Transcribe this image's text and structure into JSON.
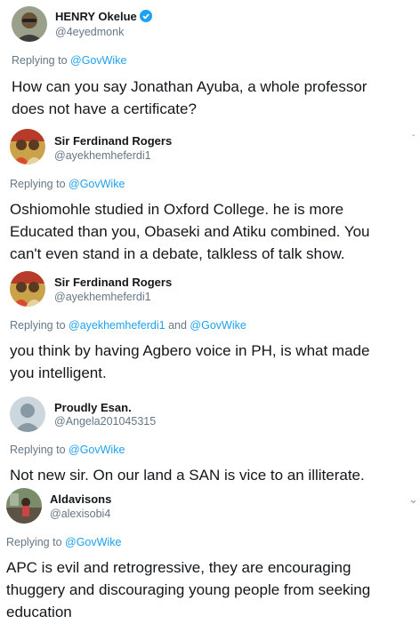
{
  "tweets": [
    {
      "name": "HENRY Okelue",
      "handle": "@4eyedmonk",
      "verified": true,
      "reply_prefix": "Replying to ",
      "reply_to": "@GovWike",
      "reply_to_2": "",
      "text_lines": [
        "How can you say Jonathan Ayuba, a whole professor",
        "does not have a certificate?"
      ]
    },
    {
      "name": "Sir Ferdinand Rogers",
      "handle": "@ayekhemheferdi1",
      "verified": false,
      "reply_prefix": "Replying to ",
      "reply_to": "@GovWike",
      "reply_to_2": "",
      "text_lines": [
        "Oshiomohle studied in Oxford College. he is more",
        "Educated than you, Obaseki and Atiku combined. You",
        "can't even stand in a debate, talkless of talk show."
      ]
    },
    {
      "name": "Sir Ferdinand Rogers",
      "handle": "@ayekhemheferdi1",
      "verified": false,
      "reply_prefix": "Replying to ",
      "reply_to": "@ayekhemheferdi1",
      "reply_and": " and ",
      "reply_to_2": "@GovWike",
      "text_lines": [
        "you think by having Agbero voice in PH, is what made",
        "you intelligent."
      ]
    },
    {
      "name": "Proudly Esan.",
      "handle": "@Angela201045315",
      "verified": false,
      "reply_prefix": "Replying to ",
      "reply_to": "@GovWike",
      "reply_to_2": "",
      "text_lines": [
        "Not new sir. On our land a SAN is vice to an illiterate."
      ]
    },
    {
      "name": "Aldavisons",
      "handle": "@alexisobi4",
      "verified": false,
      "reply_prefix": "Replying to ",
      "reply_to": "@GovWike",
      "reply_to_2": "",
      "text_lines": [
        "APC is evil and retrogressive, they are encouraging",
        "thuggery and discouraging young people from seeking",
        "education"
      ]
    }
  ],
  "icons": {
    "verified": "verified-badge-icon",
    "caret": "chevron-down-icon"
  },
  "colors": {
    "link": "#1da1f2",
    "muted": "#657786",
    "text": "#14171a"
  }
}
